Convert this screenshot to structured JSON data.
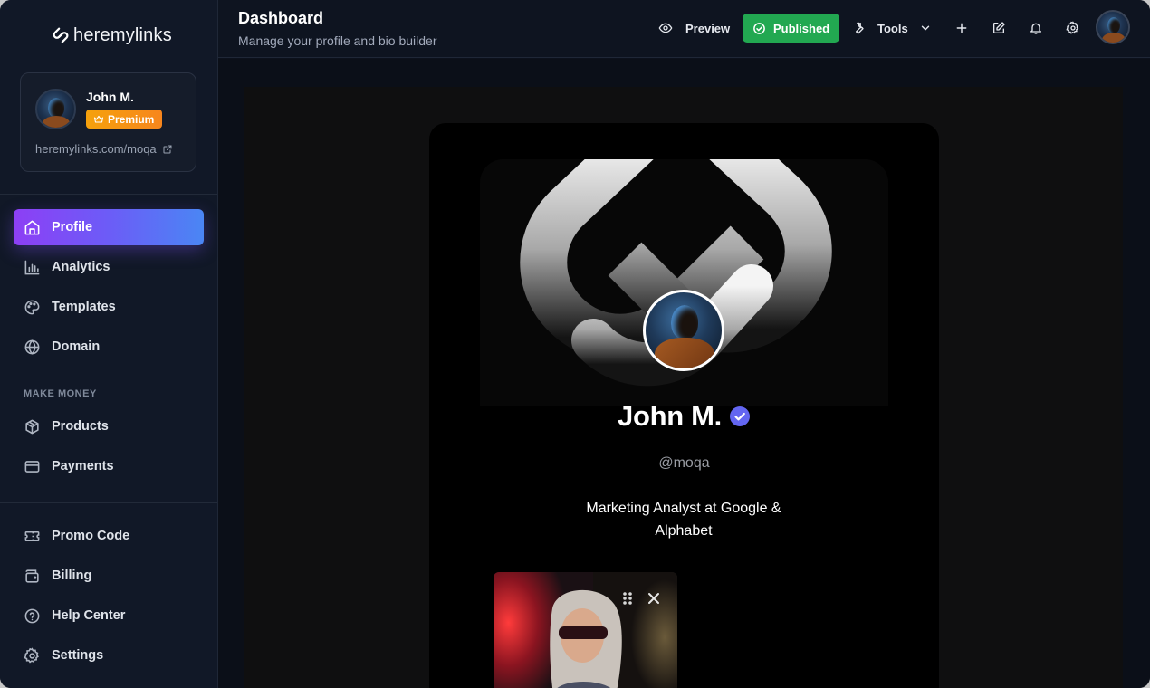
{
  "app": {
    "logo_text": "heremylinks"
  },
  "user": {
    "name": "John M.",
    "badge": "Premium",
    "link": "heremylinks.com/moqa"
  },
  "nav": {
    "profile": "Profile",
    "analytics": "Analytics",
    "templates": "Templates",
    "domain": "Domain",
    "section_make_money": "MAKE MONEY",
    "products": "Products",
    "payments": "Payments",
    "promo_code": "Promo Code",
    "billing": "Billing",
    "help_center": "Help Center",
    "settings": "Settings"
  },
  "header": {
    "title": "Dashboard",
    "subtitle": "Manage your profile and bio builder",
    "preview_label": "Preview",
    "published_label": "Published",
    "tools_label": "Tools"
  },
  "preview": {
    "name": "John M.",
    "handle": "@moqa",
    "bio": "Marketing Analyst at Google & Alphabet"
  },
  "colors": {
    "accent_start": "#8d3ff5",
    "accent_end": "#4a86f4",
    "published_green": "#22a851",
    "premium_orange": "#f5a10c",
    "verified_blue": "#6366f1"
  }
}
